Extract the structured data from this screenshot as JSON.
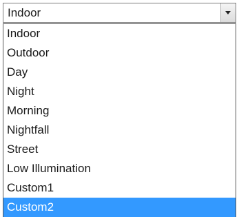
{
  "select": {
    "value": "Indoor",
    "arrow_icon": "chevron-down-icon"
  },
  "options": [
    {
      "label": "Indoor",
      "highlighted": false
    },
    {
      "label": "Outdoor",
      "highlighted": false
    },
    {
      "label": "Day",
      "highlighted": false
    },
    {
      "label": "Night",
      "highlighted": false
    },
    {
      "label": "Morning",
      "highlighted": false
    },
    {
      "label": "Nightfall",
      "highlighted": false
    },
    {
      "label": "Street",
      "highlighted": false
    },
    {
      "label": "Low Illumination",
      "highlighted": false
    },
    {
      "label": "Custom1",
      "highlighted": false
    },
    {
      "label": "Custom2",
      "highlighted": true
    }
  ],
  "colors": {
    "highlight_bg": "#3399ff",
    "highlight_text": "#ffffff"
  }
}
